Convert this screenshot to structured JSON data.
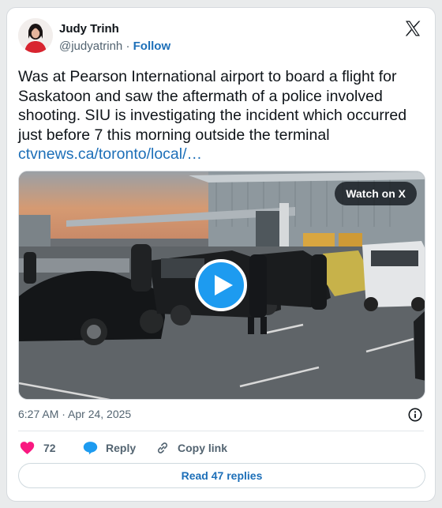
{
  "author": {
    "name": "Judy Trinh",
    "handle": "@judyatrinh",
    "separator": "·",
    "follow_label": "Follow"
  },
  "tweet": {
    "text": "Was at Pearson International airport to board a flight for Saskatoon and saw the aftermath of a police involved shooting. SIU is investigating the incident which occurred just before 7 this morning outside the terminal",
    "link_text": "ctvnews.ca/toronto/local/…"
  },
  "media": {
    "watch_label": "Watch on X"
  },
  "meta": {
    "timestamp": "6:27 AM · Apr 24, 2025"
  },
  "actions": {
    "likes_count": "72",
    "reply_label": "Reply",
    "copy_link_label": "Copy link"
  },
  "footer": {
    "read_replies_label": "Read 47 replies"
  },
  "colors": {
    "link": "#1d6fb8",
    "like": "#f91880",
    "reply": "#1d9bf0",
    "text": "#0f1419",
    "muted": "#536471"
  },
  "icons": [
    "x-logo-icon",
    "play-icon",
    "info-icon",
    "heart-icon",
    "reply-bubble-icon",
    "link-icon"
  ]
}
